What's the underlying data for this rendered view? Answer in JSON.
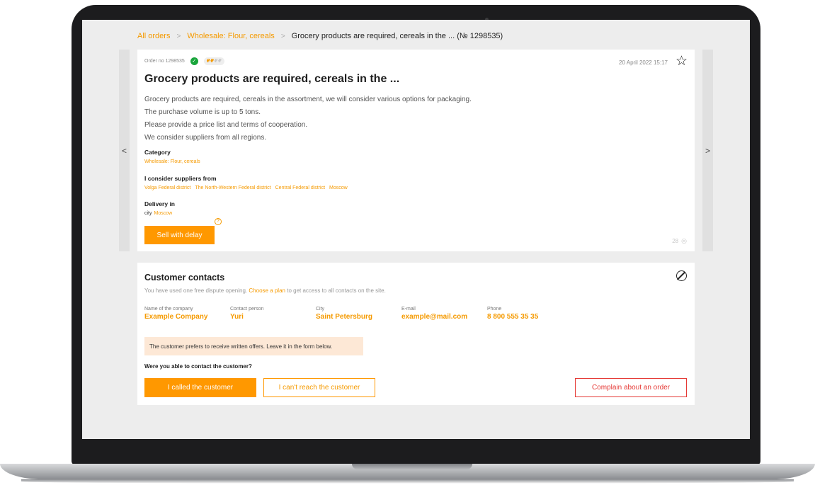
{
  "breadcrumbs": {
    "items": [
      "All orders",
      "Wholesale: Flour, cereals"
    ],
    "separator": ">",
    "current": "Grocery products are required, cereals in the ... (№ 1298535)"
  },
  "nav": {
    "prev": "<",
    "next": ">"
  },
  "order": {
    "number_label": "Order no 1298535",
    "status_icon": "check",
    "price_badge": {
      "active": "₽₽",
      "inactive": "₽₽"
    },
    "date": "20 April 2022 15:17",
    "title": "Grocery products are required, cereals in the ...",
    "description": [
      "Grocery products are required, cereals in the assortment, we will consider various options for packaging.",
      "The purchase volume is up to 5 tons.",
      "Please provide a price list and terms of cooperation.",
      "We consider suppliers from all regions."
    ],
    "category": {
      "label": "Category",
      "value": "Wholesale: Flour, cereals"
    },
    "suppliers": {
      "label": "I consider suppliers from",
      "values": [
        "Volga Federal district",
        "The North-Western Federal district",
        "Central Federal district",
        "Moscow"
      ]
    },
    "delivery": {
      "label": "Delivery in",
      "prefix": "city",
      "city": "Moscow"
    },
    "help_icon": "?",
    "sell_button": "Sell with delay",
    "views": "28"
  },
  "contacts": {
    "title": "Customer contacts",
    "notice": {
      "before": "You have used one free dispute opening.",
      "link": "Choose a plan",
      "after": "to get access to all contacts on the site."
    },
    "fields": [
      {
        "label": "Name of the company",
        "value": "Example Company"
      },
      {
        "label": "Contact person",
        "value": "Yuri"
      },
      {
        "label": "City",
        "value": "Saint Petersburg"
      },
      {
        "label": "E-mail",
        "value": "example@mail.com"
      },
      {
        "label": "Phone",
        "value": "8 800 555 35 35"
      }
    ],
    "preference": "The customer prefers to receive written offers. Leave it in the form below.",
    "question": "Were you able to contact the customer?",
    "buttons": {
      "called": "I called the customer",
      "unreachable": "I can't reach the customer",
      "complain": "Complain about an order"
    }
  },
  "colors": {
    "accent": "#ff9800",
    "accent_text": "#f59a00",
    "success": "#19a53b",
    "danger": "#e53935",
    "notice_bg": "#fde8d6"
  }
}
